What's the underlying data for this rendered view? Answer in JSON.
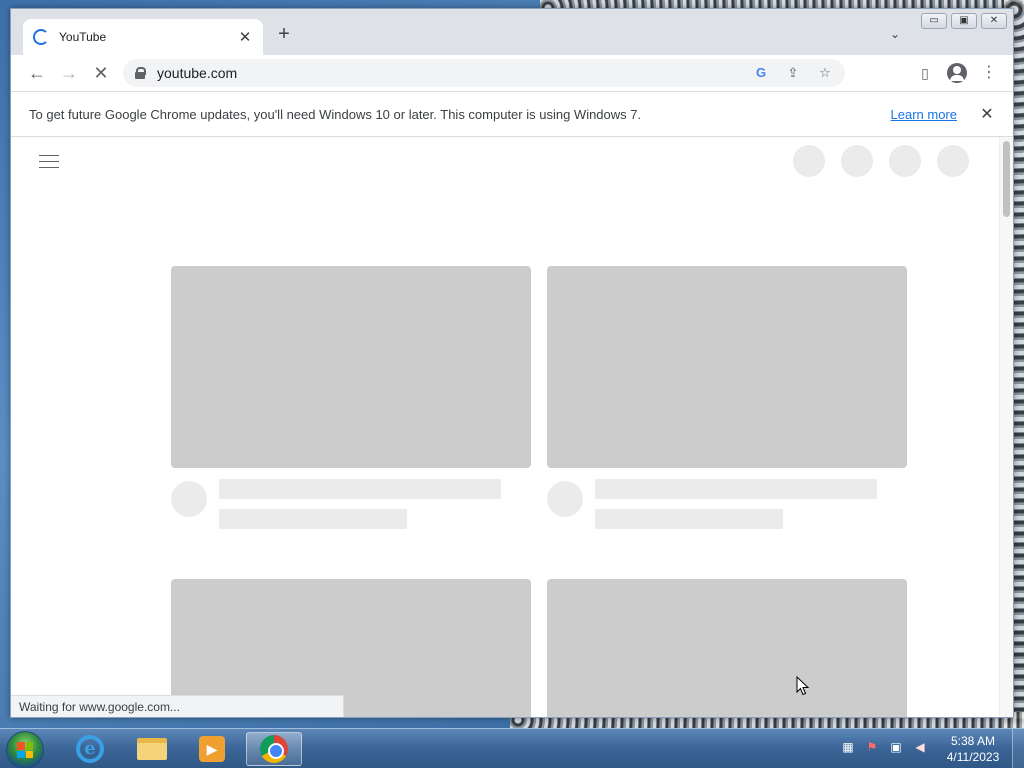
{
  "browser": {
    "tab": {
      "title": "YouTube"
    },
    "new_tab_symbol": "+",
    "tab_search_symbol": "⌄",
    "window_controls": {
      "minimize": "▭",
      "maximize": "▣",
      "close": "✕"
    },
    "toolbar": {
      "back_symbol": "←",
      "forward_symbol": "→",
      "stop_symbol": "✕",
      "url": "youtube.com"
    },
    "infobar": {
      "message": "To get future Google Chrome updates, you'll need Windows 10 or later. This computer is using Windows 7.",
      "link": "Learn more",
      "close_symbol": "✕"
    },
    "status": "Waiting for www.google.com..."
  },
  "taskbar": {
    "clock": {
      "time": "5:38 AM",
      "date": "4/11/2023"
    },
    "pinned": [
      "internet-explorer",
      "windows-explorer",
      "media-player",
      "google-chrome"
    ],
    "active_app": "google-chrome"
  },
  "colors": {
    "accent": "#1a73e8",
    "placeholder_thumb": "#cccccc",
    "placeholder_line": "#ebebeb"
  }
}
